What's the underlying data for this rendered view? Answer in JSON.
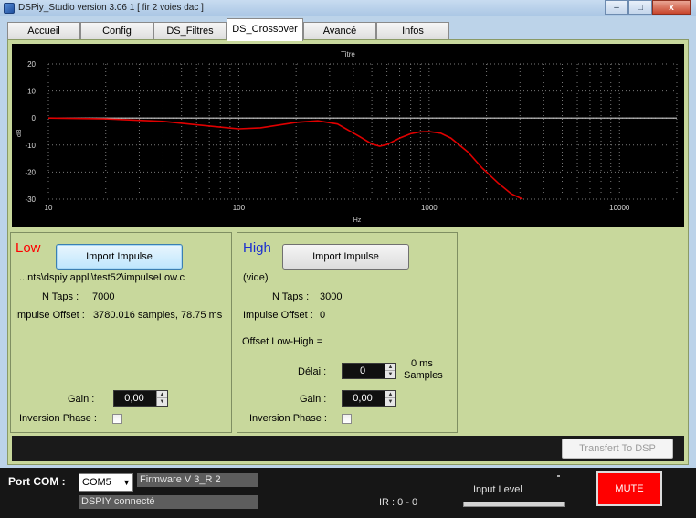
{
  "window": {
    "title": "DSPiy_Studio version 3.06 1 [ fir 2 voies dac ]",
    "controls": [
      "–",
      "□",
      "x"
    ]
  },
  "tabs": [
    "Accueil",
    "Config",
    "DS_Filtres",
    "DS_Crossover",
    "Avancé",
    "Infos"
  ],
  "active_tab": "DS_Crossover",
  "chart": {
    "title": "Titre",
    "xlabel": "Hz",
    "ylabel": "dB",
    "ytick_labels": [
      "20",
      "10",
      "0",
      "-10",
      "-20",
      "-30"
    ],
    "xtick_labels": [
      "10",
      "100",
      "1000",
      "10000"
    ],
    "colors": {
      "background": "#000000",
      "grid": "#7a7a7a",
      "flat_trace": "#d0d0d0",
      "response_trace": "#e00000"
    }
  },
  "chart_data": {
    "type": "line",
    "title": "Titre",
    "xlabel": "Hz",
    "ylabel": "dB",
    "x_scale": "log",
    "xlim": [
      10,
      20000
    ],
    "ylim": [
      -30,
      20
    ],
    "grid": true,
    "series": [
      {
        "x": [
          10,
          20000
        ],
        "y": [
          0,
          0
        ]
      },
      {
        "x": [
          10,
          20,
          40,
          60,
          100,
          130,
          200,
          260,
          330,
          430,
          500,
          550,
          600,
          700,
          800,
          900,
          1000,
          1150,
          1300,
          1600,
          1900,
          2300,
          2700,
          3100
        ],
        "y": [
          0,
          -0.3,
          -1.2,
          -2.5,
          -4.0,
          -3.6,
          -1.6,
          -1.0,
          -2.2,
          -6.8,
          -9.6,
          -10.4,
          -9.8,
          -7.4,
          -5.8,
          -5.1,
          -5.0,
          -5.6,
          -7.4,
          -12.6,
          -18.5,
          -24.0,
          -28.0,
          -30.0
        ]
      }
    ]
  },
  "low": {
    "title": "Low",
    "import_label": "Import Impulse",
    "path": "...nts\\dspiy appli\\test52\\impulseLow.c",
    "ntaps_label": "N Taps :",
    "ntaps_value": "7000",
    "offset_label": "Impulse Offset :",
    "offset_value": "3780.016 samples, 78.75 ms",
    "gain_label": "Gain :",
    "gain_value": "0,00",
    "inversion_label": "Inversion Phase :"
  },
  "high": {
    "title": "High",
    "import_label": "Import Impulse",
    "path": "(vide)",
    "ntaps_label": "N Taps :",
    "ntaps_value": "3000",
    "offset_label": "Impulse Offset :",
    "offset_value": "0",
    "offset_lh_label": "Offset Low-High =",
    "delai_label": "Délai :",
    "delai_value": "0",
    "delai_ms": "0 ms",
    "delai_samples": "Samples",
    "gain_label": "Gain :",
    "gain_value": "0,00",
    "inversion_label": "Inversion Phase :"
  },
  "transfer_label": "Transfert To DSP",
  "status": {
    "port_label": "Port COM :",
    "port_value": "COM5",
    "firmware": "Firmware V 3_R 2",
    "connection": "DSPIY connecté",
    "ir": "IR : 0 - 0",
    "input_level_label": "Input Level",
    "mute_label": "MUTE"
  },
  "colors": {
    "panel": "#c8d89c",
    "mute": "#ff0000",
    "low_title": "#ff0000",
    "high_title": "#1a2fd0"
  }
}
